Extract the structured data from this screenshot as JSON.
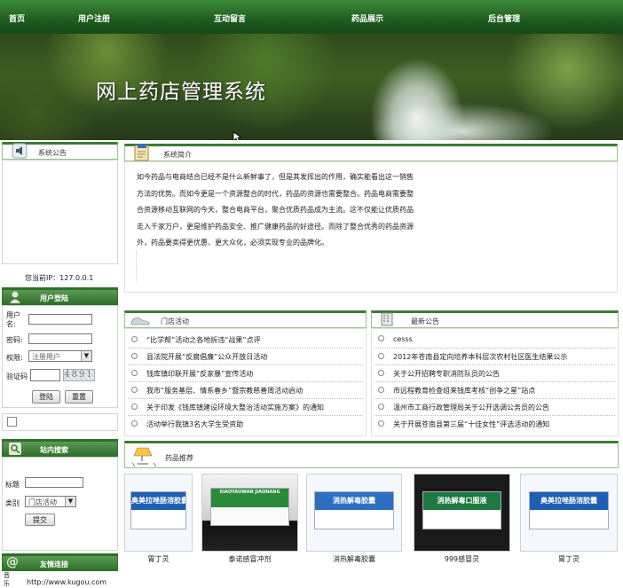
{
  "nav": [
    "首页",
    "用户注册",
    "互动留言",
    "药品展示",
    "后台管理"
  ],
  "banner_title": "网上药店管理系统",
  "announce": {
    "title": "系统公告"
  },
  "ip_text": "您当前IP：127.0.0.1",
  "login": {
    "title": "用户登陆",
    "username_label": "用户名:",
    "password_label": "密码:",
    "role_label": "权限:",
    "role_value": "注册用户",
    "captcha_label": "验证码",
    "captcha_code": "4891",
    "login_btn": "登陆",
    "reset_btn": "重置"
  },
  "search": {
    "title": "站内搜索",
    "title_label": "标题",
    "category_label": "类别",
    "category_value": "门店活动",
    "submit_btn": "提交"
  },
  "links": {
    "title": "友情连接",
    "item_prefix": "音乐",
    "item_url": "http://www.kugou.com"
  },
  "intro": {
    "title": "系统简介",
    "lines": [
      "如今药品与电商结合已经不是什么新鲜事了，但是其发挥出的作用，确实能看出这一销售",
      "方法的优势。而如今更是一个资源整合的时代，药品的资源也需要整合。药品电商需要整",
      "合资源移动互联网的今天，整合电商平台，聚合优质药品成为主流。这不仅能让优质药品",
      "走入千家万户，更是维护药品安全、推广健康药品的好途径。而除了整合优秀的药品资源",
      "外，药品要卖得更优惠、更大众化，必须实现专业的品牌化。"
    ]
  },
  "store": {
    "title": "门店活动",
    "items": [
      "“比学帮”活动之各地拆违“战果”点评",
      "县法院开展“反腐倡廉”公众开放日活动",
      "钱库镇印联开展“反家暴”宣传活动",
      "我市“服务基层、情系春乡”暨宗教慈善周活动启动",
      "关于印发《钱库镇建设环境大整治活动实施方案》的通知",
      "活动举行我镇3名大学生受资助"
    ]
  },
  "news": {
    "title": "最新公告",
    "items": [
      "cesss",
      "2012年苍南县定向培养本科层次农村社区医生结果公示",
      "关于公开招聘专职消防队员的公告",
      "市远程教育检查组来钱库考核“创争之星”站点",
      "温州市工商行政管理局关于公开选调公务员的公告",
      "关于开展苍南县第三届“十佳女性”评选活动的通知"
    ]
  },
  "recommend": {
    "title": "药品推荐",
    "products": [
      {
        "name": "胃丁灵",
        "box_text": "奥美拉唑肠溶胶囊",
        "color": "#1f5fb0"
      },
      {
        "name": "泰诺感冒冲剂",
        "box_text": "XIAOYAOWAN JIAONANG",
        "color": "#2a8a3a"
      },
      {
        "name": "消热解毒胶囊",
        "box_text": "消热解毒胶囊",
        "color": "#2c6fc0"
      },
      {
        "name": "999感冒灵",
        "box_text": "消热解毒口服液",
        "color": "#1e7a40"
      },
      {
        "name": "胃丁灵",
        "box_text": "奥美拉唑肠溶胶囊",
        "color": "#1f5fb0"
      }
    ]
  }
}
